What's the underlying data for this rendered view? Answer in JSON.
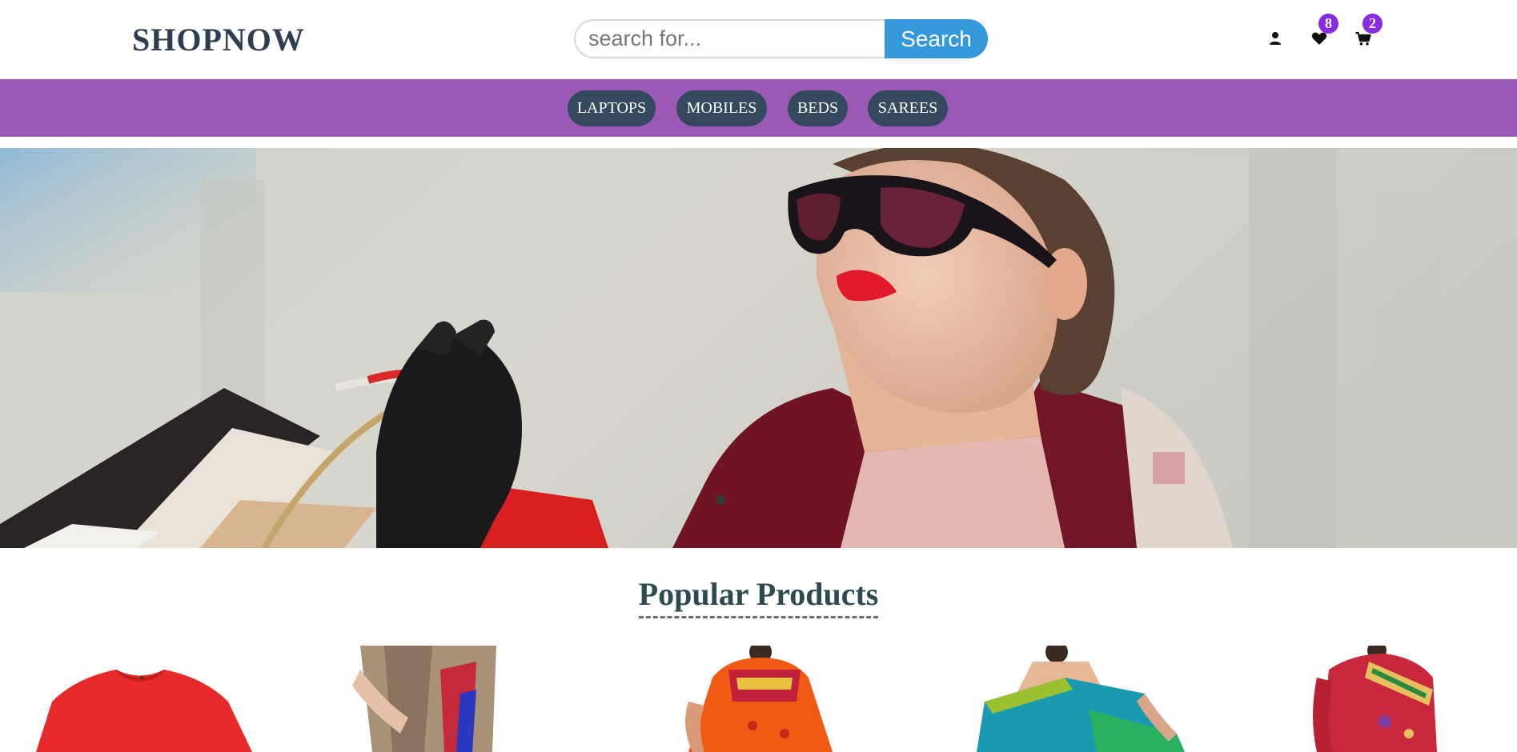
{
  "header": {
    "logo": "SHOPNOW",
    "search": {
      "placeholder": "search for...",
      "button_label": "Search"
    },
    "icons": {
      "account": "user-icon",
      "wishlist": "heart-icon",
      "cart": "cart-icon"
    },
    "wishlist_count": "8",
    "cart_count": "2"
  },
  "nav": {
    "items": [
      {
        "label": "LAPTOPS"
      },
      {
        "label": "MOBILES"
      },
      {
        "label": "BEDS"
      },
      {
        "label": "SAREES"
      }
    ]
  },
  "main": {
    "section_title": "Popular Products"
  },
  "colors": {
    "header_text": "#2c3e50",
    "search_button": "#3498db",
    "nav_bar": "#9b59b6",
    "nav_pill": "#34495e",
    "badge": "#8a2be2",
    "section_title": "#2c4a4f"
  }
}
